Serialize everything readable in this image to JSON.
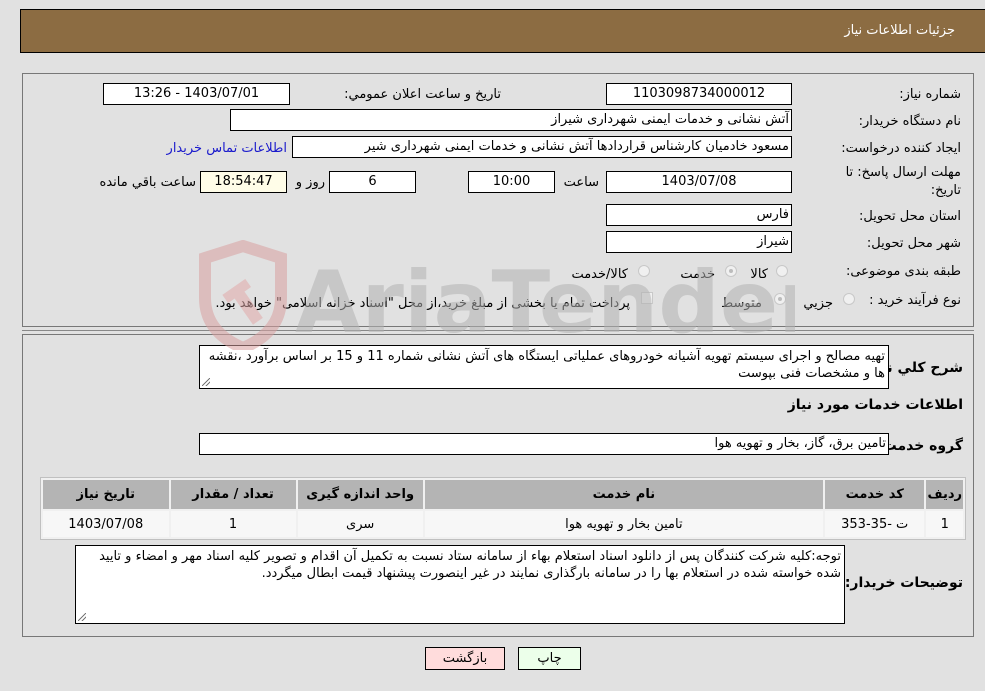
{
  "header": {
    "title": "جزئیات اطلاعات نیاز"
  },
  "details": {
    "need_number": {
      "label": "شماره نیاز:",
      "value": "1103098734000012"
    },
    "announce_datetime": {
      "label": "تاریخ و ساعت اعلان عمومي:",
      "value": "1403/07/01 - 13:26"
    },
    "buyer_org": {
      "label": "نام دستگاه خریدار:",
      "value": "آتش نشانی و خدمات ایمنی شهرداری شیراز"
    },
    "requester": {
      "label": "ایجاد کننده درخواست:",
      "value": "مسعود خادمیان کارشناس قراردادها آتش نشانی و خدمات ایمنی شهرداری شیر",
      "contact_link": "اطلاعات تماس خریدار"
    },
    "deadline": {
      "label_line1": "مهلت ارسال پاسخ: تا",
      "label_line2": "تاریخ:",
      "date": "1403/07/08",
      "time_label": "ساعت",
      "time": "10:00",
      "days": "6",
      "days_label": "روز و",
      "remaining": "18:54:47",
      "remaining_label": "ساعت باقي مانده"
    },
    "province": {
      "label": "استان محل تحویل:",
      "value": "فارس"
    },
    "city": {
      "label": "شهر محل تحویل:",
      "value": "شیراز"
    },
    "category": {
      "label": "طبقه بندی موضوعی:",
      "options": [
        {
          "label": "کالا",
          "checked": false
        },
        {
          "label": "خدمت",
          "checked": true
        },
        {
          "label": "کالا/خدمت",
          "checked": false
        }
      ]
    },
    "purchase_type": {
      "label": "نوع فرآیند خرید :",
      "options": [
        {
          "label": "جزيي",
          "checked": false
        },
        {
          "label": "متوسط",
          "checked": true
        }
      ],
      "treasury_note": "پرداخت تمام یا بخشی از مبلغ خرید،از محل \"اسناد خزانه اسلامی\" خواهد بود.",
      "treasury_checked": false
    }
  },
  "description": {
    "label": "شرح کلي نياز:",
    "value": "تهیه مصالح و اجرای سیستم تهویه آشیانه خودروهای عملیاتی ایستگاه های آتش نشانی شماره 11 و 15 بر اساس برآورد ،نقشه ها و مشخصات فنی بپوست"
  },
  "services": {
    "heading": "اطلاعات خدمات مورد نياز",
    "group_label": "گروه خدمت:",
    "group_value": "تامین برق، گاز، بخار و تهویه هوا",
    "columns": [
      "ردیف",
      "کد خدمت",
      "نام خدمت",
      "واحد اندازه گیری",
      "تعداد / مقدار",
      "تاریخ نیاز"
    ],
    "rows": [
      [
        "1",
        "ت -35-353",
        "تامین بخار و تهویه هوا",
        "سری",
        "1",
        "1403/07/08"
      ]
    ]
  },
  "buyer_notes": {
    "label": "توضیحات خریدار:",
    "value": "توجه:کلیه شرکت کنندگان پس از دانلود اسناد استعلام بهاء از سامانه ستاد نسبت به تکمیل آن اقدام و تصویر کلیه اسناد مهر و امضاء و تایید شده خواسته شده در استعلام بها را در سامانه بارگذاری نمایند در غیر اینصورت پیشنهاد قیمت ابطال میگردد."
  },
  "buttons": {
    "print": "چاپ",
    "back": "بازگشت"
  },
  "watermark": {
    "text": "AriaTender.neT"
  },
  "colors": {
    "header_bg": "#8c6c42",
    "back_button_bg": "#ffdcdc",
    "print_button_bg": "#ecffea",
    "link": "#1a1acc",
    "remaining_bg": "#fffde8"
  }
}
